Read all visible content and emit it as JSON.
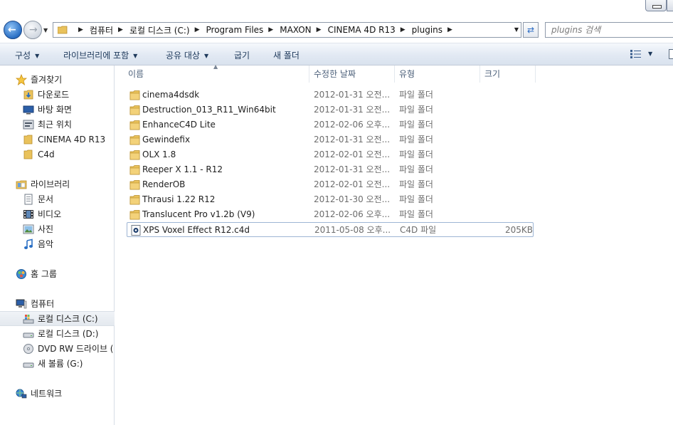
{
  "window": {
    "minimize_icon": "minimize-icon"
  },
  "nav": {
    "back_icon": "back-arrow-icon",
    "forward_icon": "forward-arrow-icon",
    "breadcrumbs": [
      "컴퓨터",
      "로컬 디스크 (C:)",
      "Program Files",
      "MAXON",
      "CINEMA 4D R13",
      "plugins"
    ],
    "search_placeholder": "plugins 검색"
  },
  "toolbar": {
    "organize": "구성",
    "include_library": "라이브러리에 포함",
    "share_with": "공유 대상",
    "burn": "굽기",
    "new_folder": "새 폴더"
  },
  "sidebar": {
    "favorites": {
      "label": "즐겨찾기",
      "items": [
        {
          "label": "다운로드",
          "icon": "download-folder-icon"
        },
        {
          "label": "바탕 화면",
          "icon": "desktop-icon"
        },
        {
          "label": "최근 위치",
          "icon": "recent-places-icon"
        },
        {
          "label": "CINEMA 4D R13",
          "icon": "folder-icon"
        },
        {
          "label": "C4d",
          "icon": "folder-icon"
        }
      ]
    },
    "libraries": {
      "label": "라이브러리",
      "items": [
        {
          "label": "문서",
          "icon": "documents-icon"
        },
        {
          "label": "비디오",
          "icon": "video-icon"
        },
        {
          "label": "사진",
          "icon": "pictures-icon"
        },
        {
          "label": "음악",
          "icon": "music-icon"
        }
      ]
    },
    "homegroup": {
      "label": "홈 그룹"
    },
    "computer": {
      "label": "컴퓨터",
      "items": [
        {
          "label": "로컬 디스크 (C:)",
          "icon": "system-drive-icon",
          "selected": true
        },
        {
          "label": "로컬 디스크 (D:)",
          "icon": "drive-icon"
        },
        {
          "label": "DVD RW 드라이브 (",
          "icon": "dvd-drive-icon"
        },
        {
          "label": "새 볼륨 (G:)",
          "icon": "drive-icon"
        }
      ]
    },
    "network": {
      "label": "네트워크"
    }
  },
  "filelist": {
    "columns": {
      "name": "이름",
      "date": "수정한 날짜",
      "type": "유형",
      "size": "크기"
    },
    "rows": [
      {
        "name": "cinema4dsdk",
        "date": "2012-01-31 오전...",
        "type": "파일 폴더",
        "size": "",
        "icon": "folder-icon"
      },
      {
        "name": "Destruction_013_R11_Win64bit",
        "date": "2012-01-31 오전...",
        "type": "파일 폴더",
        "size": "",
        "icon": "folder-icon"
      },
      {
        "name": "EnhanceC4D Lite",
        "date": "2012-02-06 오후...",
        "type": "파일 폴더",
        "size": "",
        "icon": "folder-icon"
      },
      {
        "name": "Gewindefix",
        "date": "2012-01-31 오전...",
        "type": "파일 폴더",
        "size": "",
        "icon": "folder-icon"
      },
      {
        "name": "OLX 1.8",
        "date": "2012-02-01 오전...",
        "type": "파일 폴더",
        "size": "",
        "icon": "folder-icon"
      },
      {
        "name": "Reeper X 1.1 - R12",
        "date": "2012-01-31 오전...",
        "type": "파일 폴더",
        "size": "",
        "icon": "folder-icon"
      },
      {
        "name": "RenderOB",
        "date": "2012-02-01 오전...",
        "type": "파일 폴더",
        "size": "",
        "icon": "folder-icon"
      },
      {
        "name": "Thrausi 1.22 R12",
        "date": "2012-01-30 오전...",
        "type": "파일 폴더",
        "size": "",
        "icon": "folder-icon"
      },
      {
        "name": "Translucent Pro v1.2b (V9)",
        "date": "2012-02-06 오후...",
        "type": "파일 폴더",
        "size": "",
        "icon": "folder-icon"
      },
      {
        "name": "XPS Voxel Effect R12.c4d",
        "date": "2011-05-08 오후...",
        "type": "C4D 파일",
        "size": "205KB",
        "icon": "c4d-file-icon",
        "focused": true
      }
    ]
  }
}
